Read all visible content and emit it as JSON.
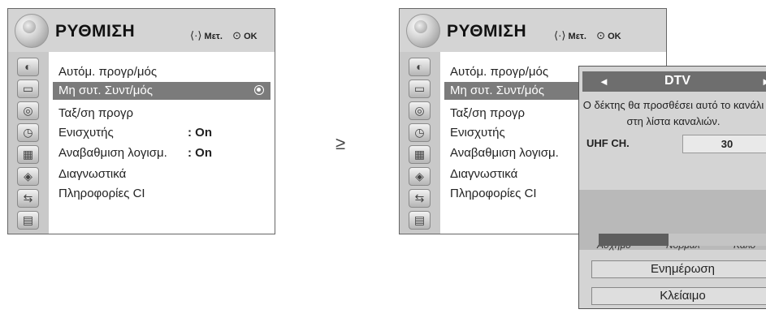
{
  "arrow_symbol": "≥",
  "menus": [
    {
      "title": "ΡΥΘΜΙΣΗ",
      "hint_move_symbol": "⟨·⟩",
      "hint_move": "Μετ.",
      "hint_ok_symbol": "⊙",
      "hint_ok": "OK",
      "items": [
        {
          "label": "Αυτόμ. προγρ/μός",
          "value": ""
        },
        {
          "label": "Μη συτ. Συντ/μός",
          "value": ""
        },
        {
          "label": "Ταξ/ση προγρ",
          "value": ""
        },
        {
          "label": "Ενισχυτής",
          "value": ": On"
        },
        {
          "label": "Αναβαθμιση λογισμ.",
          "value": ": On"
        },
        {
          "label": "Διαγνωστικά",
          "value": ""
        },
        {
          "label": "Πληροφορίες CI",
          "value": ""
        }
      ]
    },
    {
      "title": "ΡΥΘΜΙΣΗ",
      "hint_move_symbol": "⟨·⟩",
      "hint_move": "Μετ.",
      "hint_ok_symbol": "⊙",
      "hint_ok": "OK",
      "items": [
        {
          "label": "Αυτόμ. προγρ/μός"
        },
        {
          "label": "Μη συτ. Συντ/μός"
        },
        {
          "label": "Ταξ/ση προγρ"
        },
        {
          "label": "Ενισχυτής"
        },
        {
          "label": "Αναβαθμιση λογισμ."
        },
        {
          "label": "Διαγνωστικά"
        },
        {
          "label": "Πληροφορίες CI"
        }
      ]
    }
  ],
  "popup": {
    "left_arrow": "◄",
    "mode": "DTV",
    "right_arrow": "►",
    "message": "Ο δέκτης θα προσθέσει αυτό το κανάλι στη λίστα καναλιών.",
    "uhf_label": "UHF CH.",
    "uhf_value": "30",
    "signal_bad": "Ασχημο",
    "signal_normal": "Νορμάλ",
    "signal_good": "Καλό",
    "signal_level_fraction": 0.4,
    "update_button": "Ενημέρωση",
    "lock_button": "Κλείαιμο"
  }
}
